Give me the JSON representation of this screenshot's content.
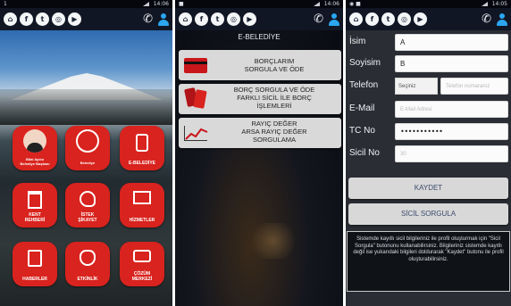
{
  "screens": [
    {
      "status": {
        "left": "1",
        "time": "14:06"
      },
      "social": [
        "f",
        "t",
        "◎",
        "▶"
      ],
      "tiles": [
        {
          "label": "Bilal Ayılııı\nBelediye Başkanı",
          "icon": "mayor-photo-icon"
        },
        {
          "label": "Belediye",
          "icon": "municipality-seal-icon"
        },
        {
          "label": "E-BELEDİYE",
          "icon": "mobile-phone-icon"
        },
        {
          "label": "KENT\nREHBERİ",
          "icon": "column-icon"
        },
        {
          "label": "İSTEK\nŞİKAYET",
          "icon": "head-gear-icon"
        },
        {
          "label": "HİZMETLER",
          "icon": "presentation-board-icon"
        },
        {
          "label": "HABERLER",
          "icon": "newspaper-icon"
        },
        {
          "label": "ETKİNLİK",
          "icon": "theater-mask-icon"
        },
        {
          "label": "ÇÖZÜM\nMERKEZİ",
          "icon": "chat-bubbles-icon"
        }
      ]
    },
    {
      "status": {
        "left": "■",
        "time": "14:06"
      },
      "title": "E-BELEDİYE",
      "menu": [
        {
          "label": "BORÇLARIM\nSORGULA VE ÖDE",
          "icon": "credit-card-icon"
        },
        {
          "label": "BORÇ SORGULA VE ÖDE\nFARKLI SİCİL İLE BORÇ\nİŞLEMLERİ",
          "icon": "cards-icon"
        },
        {
          "label": "RAYIÇ DEĞER\nARSA RAYIÇ DEĞER\nSORGULAMA",
          "icon": "line-chart-icon"
        }
      ]
    },
    {
      "status": {
        "left": "◉ ■",
        "time": "14:05"
      },
      "form": {
        "name_label": "İsim",
        "name_value": "A",
        "surname_label": "Soyisim",
        "surname_value": "B",
        "phone_label": "Telefon",
        "phone_select": "Seçiniz",
        "phone_placeholder": "Telefon numaranız",
        "email_label": "E-Mail",
        "email_placeholder": "E-Mail Adresi",
        "tc_label": "TC No",
        "tc_value": "•••••••••••",
        "sicil_label": "Sicil No",
        "sicil_placeholder": "30"
      },
      "buttons": {
        "save": "KAYDET",
        "sicil_query": "SİCİL SORGULA"
      },
      "info": "Sistemde kayıtlı sicil bilgileriniz ile profil oluşturmak için \"Sicil Sorgula\" butonunu kullanabilirsiniz. Bilgileriniz sistemde kayıtlı değil ise yukarıdaki bilgileri doldurarak \"Kaydet\" butonu ile profil oluşturabilirsiniz."
    }
  ]
}
